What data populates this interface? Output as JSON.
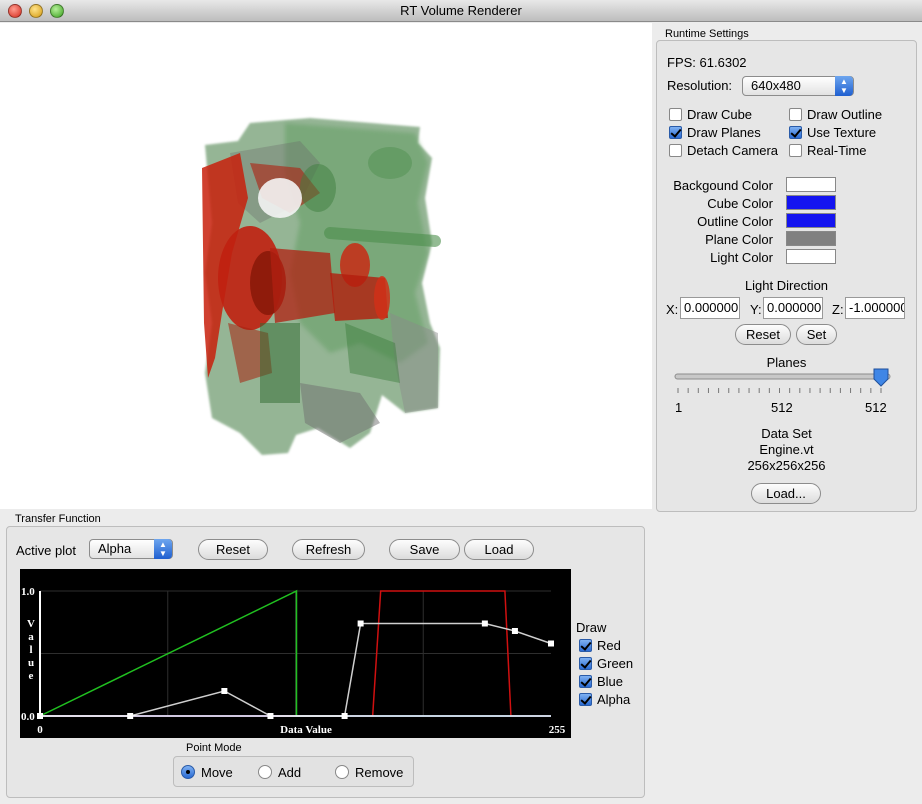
{
  "window": {
    "title": "RT Volume Renderer"
  },
  "runtime": {
    "group_title": "Runtime Settings",
    "fps_label": "FPS:",
    "fps_value": "61.6302",
    "resolution_label": "Resolution:",
    "resolution_value": "640x480",
    "checkboxes": {
      "draw_cube": {
        "label": "Draw Cube",
        "checked": false
      },
      "draw_outline": {
        "label": "Draw Outline",
        "checked": false
      },
      "draw_planes": {
        "label": "Draw Planes",
        "checked": true
      },
      "use_texture": {
        "label": "Use Texture",
        "checked": true
      },
      "detach_camera": {
        "label": "Detach Camera",
        "checked": false
      },
      "real_time": {
        "label": "Real-Time",
        "checked": false
      }
    },
    "colors": {
      "background": {
        "label": "Backgound Color",
        "value": "#ffffff"
      },
      "cube": {
        "label": "Cube Color",
        "value": "#1414f0"
      },
      "outline": {
        "label": "Outline Color",
        "value": "#1414f0"
      },
      "plane": {
        "label": "Plane Color",
        "value": "#808080"
      },
      "light": {
        "label": "Light Color",
        "value": "#ffffff"
      }
    },
    "light_direction": {
      "title": "Light Direction",
      "x_label": "X:",
      "x_value": "0.000000",
      "y_label": "Y:",
      "y_value": "0.000000",
      "z_label": "Z:",
      "z_value": "-1.000000",
      "reset_label": "Reset",
      "set_label": "Set"
    },
    "planes": {
      "title": "Planes",
      "min_label": "1",
      "mid_label": "512",
      "max_label": "512",
      "min": 1,
      "max": 512,
      "value": 512
    },
    "dataset": {
      "title": "Data Set",
      "name": "Engine.vt",
      "dims": "256x256x256",
      "load_label": "Load..."
    }
  },
  "transfer": {
    "group_title": "Transfer Function",
    "active_plot_label": "Active plot",
    "active_plot_value": "Alpha",
    "reset_label": "Reset",
    "refresh_label": "Refresh",
    "save_label": "Save",
    "load_label": "Load",
    "draw": {
      "title": "Draw",
      "red": {
        "label": "Red",
        "checked": true
      },
      "green": {
        "label": "Green",
        "checked": true
      },
      "blue": {
        "label": "Blue",
        "checked": true
      },
      "alpha": {
        "label": "Alpha",
        "checked": true
      }
    },
    "point_mode": {
      "title": "Point Mode",
      "move_label": "Move",
      "add_label": "Add",
      "remove_label": "Remove",
      "selected": "move"
    }
  },
  "chart_data": {
    "type": "line",
    "xlabel": "Data Value",
    "ylabel": "Value",
    "xlim": [
      0,
      255
    ],
    "ylim": [
      0,
      1
    ],
    "x_ticks": [
      "0",
      "255"
    ],
    "y_ticks": [
      "0.0",
      "1.0"
    ],
    "grid": true,
    "series": [
      {
        "name": "Red",
        "color": "#d01010",
        "x": [
          0,
          166,
          170,
          232,
          235,
          255
        ],
        "y": [
          0,
          0,
          1.0,
          1.0,
          0,
          0
        ]
      },
      {
        "name": "Green",
        "color": "#20c020",
        "x": [
          0,
          128,
          128,
          255
        ],
        "y": [
          0,
          1.0,
          0,
          0
        ]
      },
      {
        "name": "Blue",
        "color": "#2040ff",
        "x": [
          0,
          255
        ],
        "y": [
          0,
          0
        ]
      },
      {
        "name": "Alpha",
        "color": "#cfcfcf",
        "markers": true,
        "x": [
          0,
          45,
          92,
          115,
          152,
          160,
          222,
          237,
          255
        ],
        "y": [
          0,
          0,
          0.2,
          0,
          0,
          0.74,
          0.74,
          0.68,
          0.58
        ]
      }
    ]
  }
}
